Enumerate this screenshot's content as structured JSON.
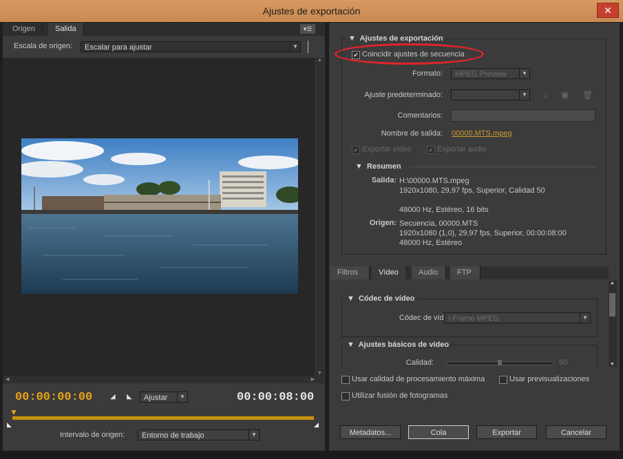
{
  "window": {
    "title": "Ajustes de exportación",
    "close_label": "✕"
  },
  "left": {
    "tabs": [
      {
        "label": "Origen"
      },
      {
        "label": "Salida"
      }
    ],
    "menu_icon": "panel-menu-icon",
    "source_scale_label": "Escala de origen:",
    "source_scale_value": "Escalar para ajustar",
    "timecode_start": "00:00:00:00",
    "timecode_end": "00:00:08:00",
    "fit_value": "Ajustar",
    "source_range_label": "Intervalo de origen:",
    "source_range_value": "Entorno de trabajo"
  },
  "export": {
    "section_title": "Ajustes de exportación",
    "match_sequence_label": "Coincidir ajustes de secuencia",
    "match_sequence_checked": true,
    "format_label": "Formato:",
    "format_value": "MPEG Preview",
    "preset_label": "Ajuste predeterminado:",
    "preset_value": "",
    "comments_label": "Comentarios:",
    "output_name_label": "Nombre de salida:",
    "output_name_value": "00000.MTS.mpeg",
    "export_video_label": "Exportar vídeo",
    "export_audio_label": "Exportar audio",
    "summary_title": "Resumen",
    "output_label": "Salida:",
    "output_lines": [
      "H:\\00000.MTS.mpeg",
      "1920x1080, 29,97 fps, Superior, Calidad 50",
      "",
      "48000 Hz, Estéreo, 16 bits"
    ],
    "source_label": "Origen:",
    "source_lines": [
      "Secuencia, 00000.MTS",
      "1920x1080 (1,0), 29,97 fps, Superior, 00:00:08:00",
      "48000 Hz, Estéreo"
    ]
  },
  "bottom_tabs": [
    {
      "label": "Filtros"
    },
    {
      "label": "Vídeo"
    },
    {
      "label": "Audio"
    },
    {
      "label": "FTP"
    }
  ],
  "video": {
    "codec_section": "Códec de vídeo",
    "codec_label": "Códec de vídeo:",
    "codec_value": "I-Frame MPEG",
    "basic_section": "Ajustes básicos de vídeo",
    "quality_label": "Calidad:",
    "quality_value": "50"
  },
  "options": {
    "max_quality": "Usar calidad de procesamiento máxima",
    "use_previews": "Usar previsualizaciones",
    "frame_blending": "Utilizar fusión de fotogramas"
  },
  "buttons": {
    "metadata": "Metadatos...",
    "queue": "Cola",
    "export": "Exportar",
    "cancel": "Cancelar"
  },
  "colors": {
    "timecode": "#e8a317",
    "highlight": "#e0242a",
    "titlebar": "#d69a60"
  }
}
